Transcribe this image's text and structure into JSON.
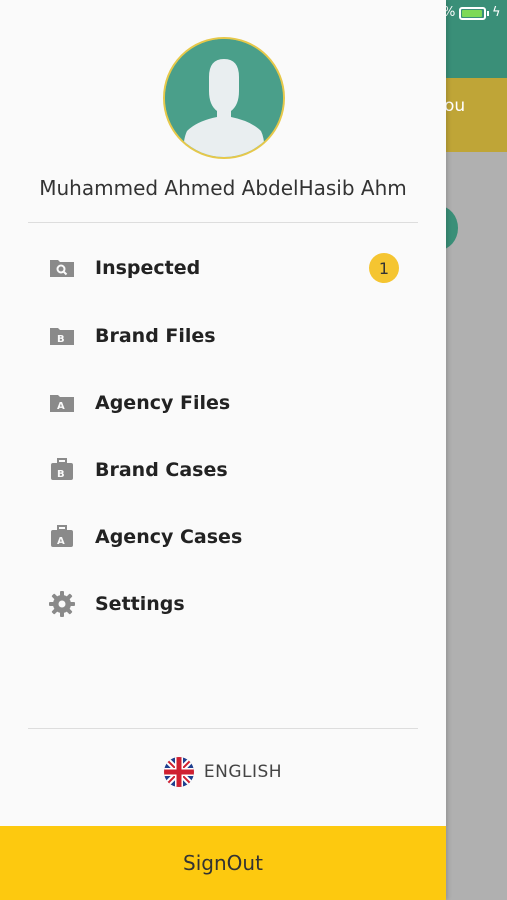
{
  "status_bar": {
    "battery_text": "%",
    "battery_level": 0.95,
    "charging_icon": "bolt-icon"
  },
  "background": {
    "banner_text": "ou"
  },
  "drawer": {
    "user_name": "Muhammed Ahmed AbdelHasib Ahm",
    "menu": [
      {
        "label": "Inspected",
        "icon": "search-folder-icon",
        "badge": "1"
      },
      {
        "label": "Brand Files",
        "icon": "brand-folder-icon"
      },
      {
        "label": "Agency Files",
        "icon": "agency-folder-icon"
      },
      {
        "label": "Brand Cases",
        "icon": "brand-case-icon"
      },
      {
        "label": "Agency Cases",
        "icon": "agency-case-icon"
      },
      {
        "label": "Settings",
        "icon": "gear-icon"
      }
    ],
    "language": {
      "label": "ENGLISH",
      "icon": "uk-flag-icon"
    },
    "signout_label": "SignOut"
  },
  "colors": {
    "accent_green": "#3a8f78",
    "accent_yellow": "#fdc90f",
    "badge_yellow": "#f5c531",
    "icon_gray": "#8a8a8a"
  }
}
